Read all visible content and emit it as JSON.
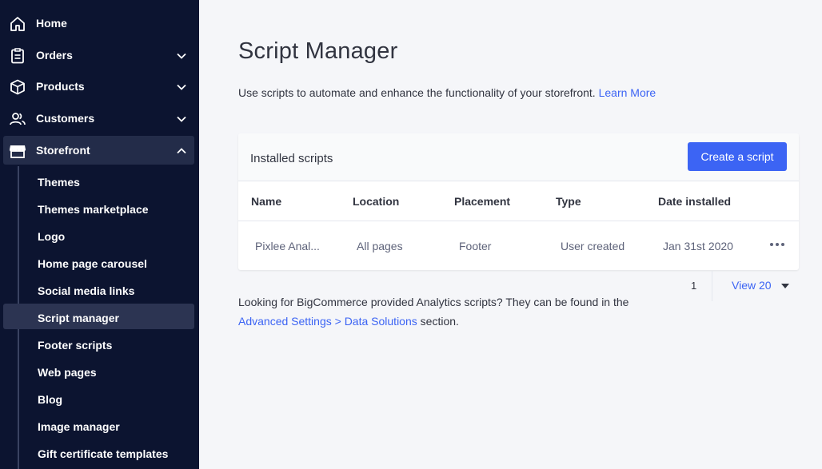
{
  "sidebar": {
    "nav": [
      {
        "label": "Home",
        "icon": "home-icon"
      },
      {
        "label": "Orders",
        "icon": "orders-icon"
      },
      {
        "label": "Products",
        "icon": "products-icon"
      },
      {
        "label": "Customers",
        "icon": "customers-icon"
      },
      {
        "label": "Storefront",
        "icon": "storefront-icon"
      }
    ],
    "storefront_sub": [
      "Themes",
      "Themes marketplace",
      "Logo",
      "Home page carousel",
      "Social media links",
      "Script manager",
      "Footer scripts",
      "Web pages",
      "Blog",
      "Image manager",
      "Gift certificate templates"
    ],
    "active_item": "Script manager"
  },
  "main": {
    "title": "Script Manager",
    "intro_text": "Use scripts to automate and enhance the functionality of your storefront.",
    "intro_link": "Learn More",
    "card_title": "Installed scripts",
    "create_button": "Create a script",
    "columns": [
      "Name",
      "Location",
      "Placement",
      "Type",
      "Date installed"
    ],
    "rows": [
      {
        "name": "Pixlee Anal...",
        "location": "All pages",
        "placement": "Footer",
        "type": "User created",
        "date": "Jan 31st 2020"
      }
    ],
    "pager": {
      "page": "1",
      "view": "View 20"
    },
    "footnote_text": "Looking for BigCommerce provided Analytics scripts? They can be found in the",
    "footnote_link": "Advanced Settings > Data Solutions",
    "footnote_tail": "section."
  },
  "colors": {
    "sidebar_bg": "#0c1430",
    "accent": "#3c64f4",
    "page_bg": "#f5f6f9"
  }
}
